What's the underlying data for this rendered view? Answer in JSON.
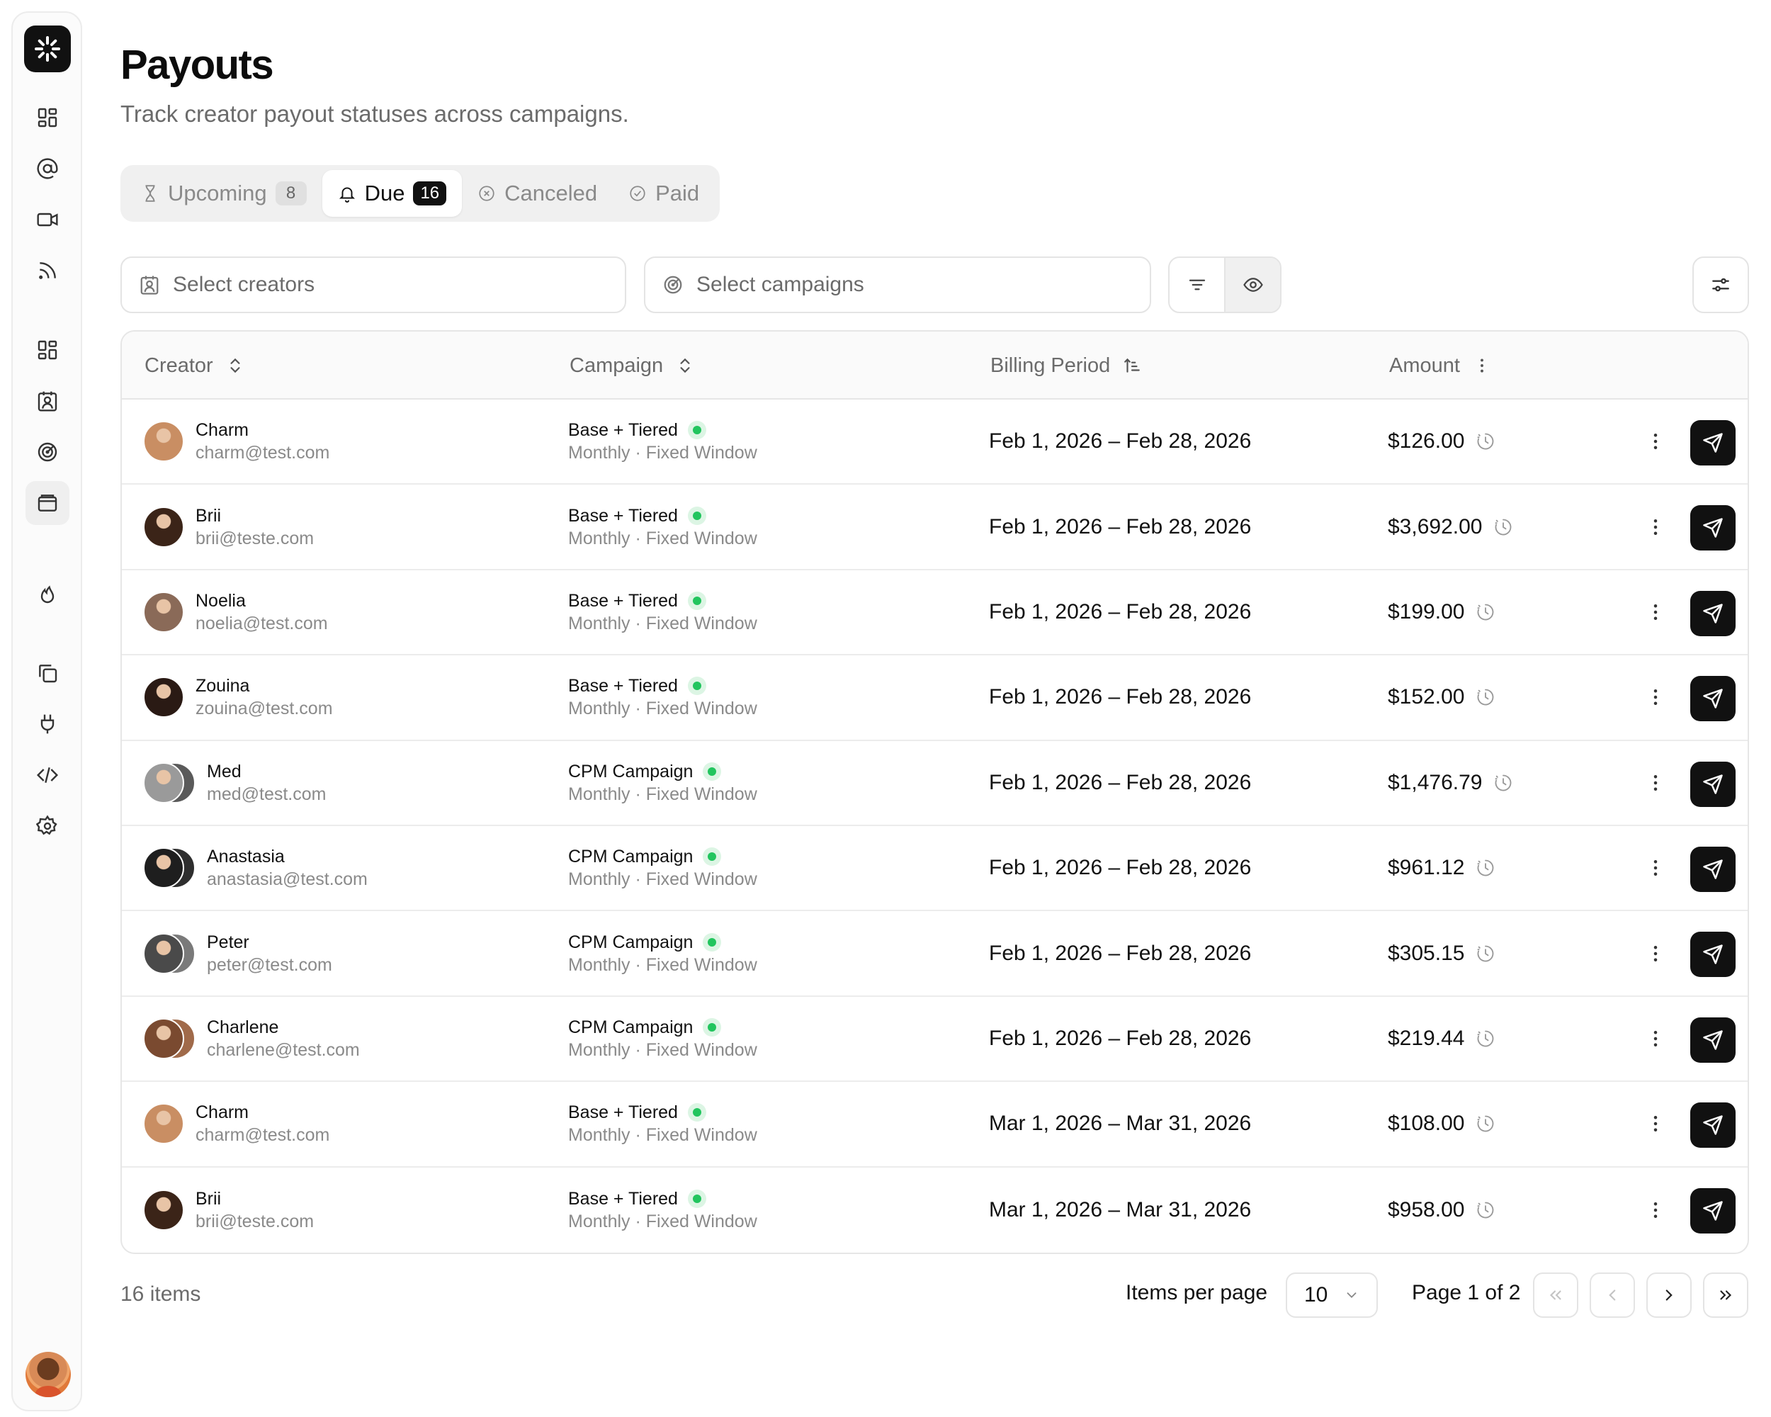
{
  "app": {
    "logo_icon": "asterisk-logo-icon"
  },
  "sidebar": {
    "items": [
      {
        "icon": "dashboard-icon"
      },
      {
        "icon": "at-sign-icon"
      },
      {
        "icon": "video-icon"
      },
      {
        "icon": "rss-icon"
      },
      {
        "icon": "grid-icon"
      },
      {
        "icon": "contact-badge-icon"
      },
      {
        "icon": "target-icon"
      },
      {
        "icon": "wallet-icon",
        "active": true
      },
      {
        "icon": "flame-icon"
      },
      {
        "icon": "copy-icon"
      },
      {
        "icon": "plug-icon"
      },
      {
        "icon": "code-icon"
      },
      {
        "icon": "gear-icon"
      }
    ]
  },
  "header": {
    "title": "Payouts",
    "subtitle": "Track creator payout statuses across campaigns."
  },
  "tabs": [
    {
      "label": "Upcoming",
      "count": "8",
      "icon": "hourglass-icon",
      "active": false
    },
    {
      "label": "Due",
      "count": "16",
      "icon": "bell-icon",
      "active": true
    },
    {
      "label": "Canceled",
      "icon": "x-circle-icon",
      "active": false
    },
    {
      "label": "Paid",
      "icon": "check-circle-icon",
      "active": false
    }
  ],
  "filters": {
    "creators_placeholder": "Select creators",
    "campaigns_placeholder": "Select campaigns"
  },
  "table": {
    "columns": {
      "creator": "Creator",
      "campaign": "Campaign",
      "billing_period": "Billing Period",
      "amount": "Amount"
    },
    "rows": [
      {
        "name": "Charm",
        "email": "charm@test.com",
        "campaign": "Base + Tiered",
        "meta": "Monthly · Fixed Window",
        "period": "Feb 1, 2026 – Feb 28, 2026",
        "amount": "$126.00",
        "avatars": [
          "#c98e63"
        ]
      },
      {
        "name": "Brii",
        "email": "brii@teste.com",
        "campaign": "Base + Tiered",
        "meta": "Monthly · Fixed Window",
        "period": "Feb 1, 2026 – Feb 28, 2026",
        "amount": "$3,692.00",
        "avatars": [
          "#3b2418"
        ]
      },
      {
        "name": "Noelia",
        "email": "noelia@test.com",
        "campaign": "Base + Tiered",
        "meta": "Monthly · Fixed Window",
        "period": "Feb 1, 2026 – Feb 28, 2026",
        "amount": "$199.00",
        "avatars": [
          "#8a6a58"
        ]
      },
      {
        "name": "Zouina",
        "email": "zouina@test.com",
        "campaign": "Base + Tiered",
        "meta": "Monthly · Fixed Window",
        "period": "Feb 1, 2026 – Feb 28, 2026",
        "amount": "$152.00",
        "avatars": [
          "#2a1a14"
        ]
      },
      {
        "name": "Med",
        "email": "med@test.com",
        "campaign": "CPM Campaign",
        "meta": "Monthly · Fixed Window",
        "period": "Feb 1, 2026 – Feb 28, 2026",
        "amount": "$1,476.79",
        "avatars": [
          "#9a9a9a",
          "#5a5a5a"
        ]
      },
      {
        "name": "Anastasia",
        "email": "anastasia@test.com",
        "campaign": "CPM Campaign",
        "meta": "Monthly · Fixed Window",
        "period": "Feb 1, 2026 – Feb 28, 2026",
        "amount": "$961.12",
        "avatars": [
          "#1e1e1e",
          "#2e2e2e"
        ]
      },
      {
        "name": "Peter",
        "email": "peter@test.com",
        "campaign": "CPM Campaign",
        "meta": "Monthly · Fixed Window",
        "period": "Feb 1, 2026 – Feb 28, 2026",
        "amount": "$305.15",
        "avatars": [
          "#4a4a4a",
          "#7a7a7a"
        ]
      },
      {
        "name": "Charlene",
        "email": "charlene@test.com",
        "campaign": "CPM Campaign",
        "meta": "Monthly · Fixed Window",
        "period": "Feb 1, 2026 – Feb 28, 2026",
        "amount": "$219.44",
        "avatars": [
          "#7a4a30",
          "#a06a4a"
        ]
      },
      {
        "name": "Charm",
        "email": "charm@test.com",
        "campaign": "Base + Tiered",
        "meta": "Monthly · Fixed Window",
        "period": "Mar 1, 2026 – Mar 31, 2026",
        "amount": "$108.00",
        "avatars": [
          "#c98e63"
        ]
      },
      {
        "name": "Brii",
        "email": "brii@teste.com",
        "campaign": "Base + Tiered",
        "meta": "Monthly · Fixed Window",
        "period": "Mar 1, 2026 – Mar 31, 2026",
        "amount": "$958.00",
        "avatars": [
          "#3b2418"
        ]
      }
    ]
  },
  "footer": {
    "items_count": "16 items",
    "items_per_page_label": "Items per page",
    "items_per_page_value": "10",
    "page_info": "Page 1 of 2"
  },
  "colors": {
    "accent": "#111111",
    "live_green": "#22c55e",
    "muted_text": "#6b6b6b"
  }
}
